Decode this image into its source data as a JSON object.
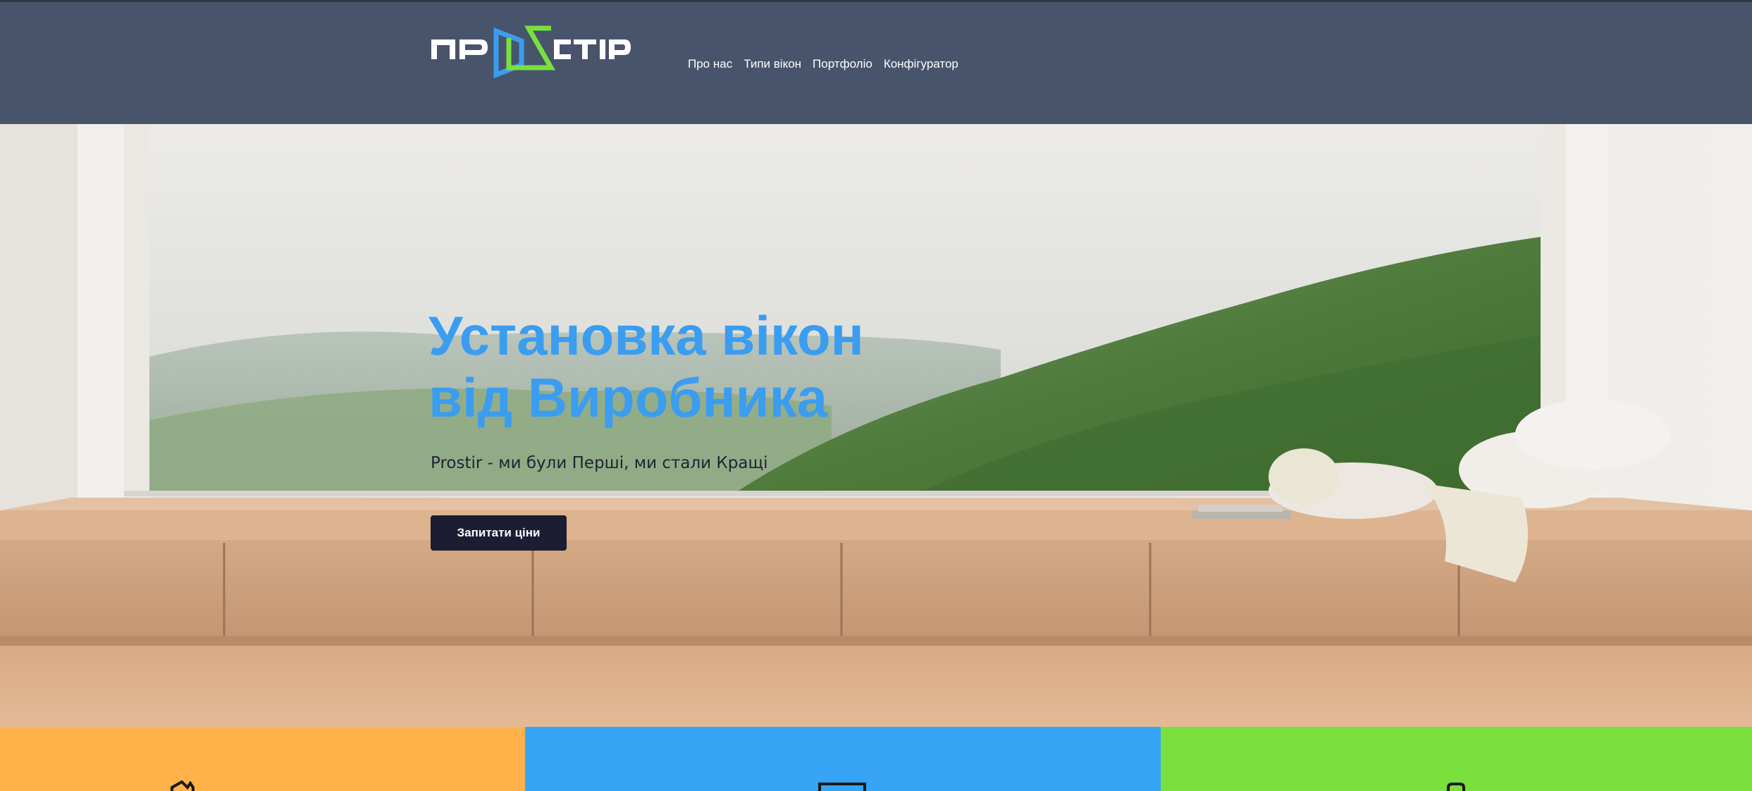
{
  "logo": {
    "text": "ПРОСТІР",
    "colors": {
      "blue": "#3a9df0",
      "green": "#79e03e"
    }
  },
  "nav": {
    "items": [
      {
        "label": "Про нас"
      },
      {
        "label": "Типи вікон"
      },
      {
        "label": "Портфоліо"
      },
      {
        "label": "Конфігуратор"
      }
    ]
  },
  "hero": {
    "title_line1": "Установка вікон",
    "title_line2": "від Виробника",
    "subtitle": "Prostir - ми були Перші, ми стали Кращі",
    "cta_label": "Запитати ціни",
    "background": "panoramic-window-mountain-view"
  },
  "features": [
    {
      "color": "#ffb24a",
      "icon": "house-icon"
    },
    {
      "color": "#37a4f5",
      "icon": "window-icon"
    },
    {
      "color": "#79e03e",
      "icon": "lock-icon"
    }
  ],
  "colors": {
    "header": "#48546b",
    "title": "#3a9df0",
    "button": "#1c1c33"
  }
}
